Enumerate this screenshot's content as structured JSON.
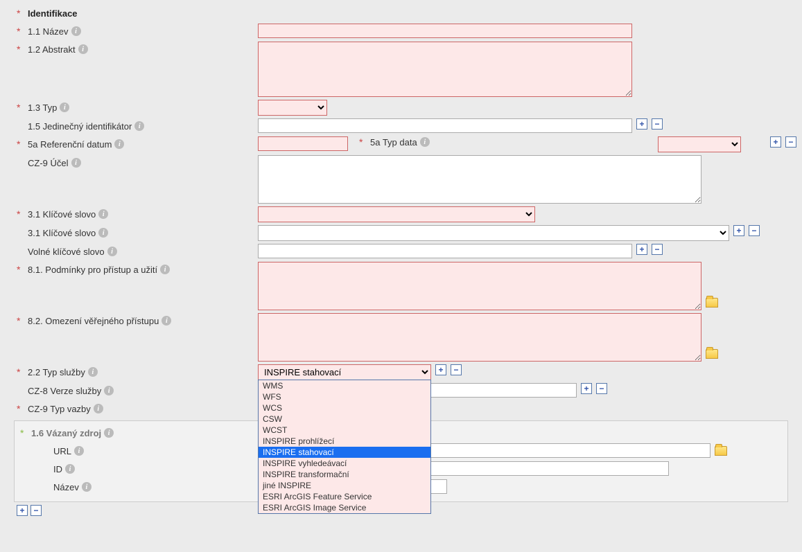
{
  "section": {
    "title": "Identifikace"
  },
  "fields": {
    "nazev": {
      "label": "1.1 Název"
    },
    "abstrakt": {
      "label": "1.2 Abstrakt"
    },
    "typ": {
      "label": "1.3 Typ"
    },
    "identifikator": {
      "label": "1.5 Jedinečný identifikátor"
    },
    "ref_datum": {
      "label": "5a Referenční datum"
    },
    "typ_data": {
      "label": "5a Typ data"
    },
    "ucel": {
      "label": "CZ-9 Účel"
    },
    "klic1": {
      "label": "3.1 Klíčové slovo"
    },
    "klic2": {
      "label": "3.1 Klíčové slovo"
    },
    "volne_klic": {
      "label": "Volné klíčové slovo"
    },
    "podminky": {
      "label": "8.1. Podmínky pro přístup a užití"
    },
    "omezeni": {
      "label": "8.2. Omezení věřejného přístupu"
    },
    "typ_sluzby": {
      "label": "2.2 Typ služby",
      "value": "INSPIRE stahovací"
    },
    "verze_sluzby": {
      "label": "CZ-8 Verze služby"
    },
    "typ_vazby": {
      "label": "CZ-9 Typ vazby"
    }
  },
  "subsection": {
    "title": "1.6 Vázaný zdroj",
    "url": {
      "label": "URL"
    },
    "id": {
      "label": "ID"
    },
    "nazev": {
      "label": "Název"
    }
  },
  "dropdown_options": [
    "WMS",
    "WFS",
    "WCS",
    "CSW",
    "WCST",
    "INSPIRE prohlížecí",
    "INSPIRE stahovací",
    "INSPIRE vyhledeávací",
    "INSPIRE transformační",
    "jiné INSPIRE",
    "ESRI ArcGIS Feature Service",
    "ESRI ArcGIS Image Service"
  ],
  "icons": {
    "info": "i",
    "plus": "+",
    "minus": "−"
  }
}
